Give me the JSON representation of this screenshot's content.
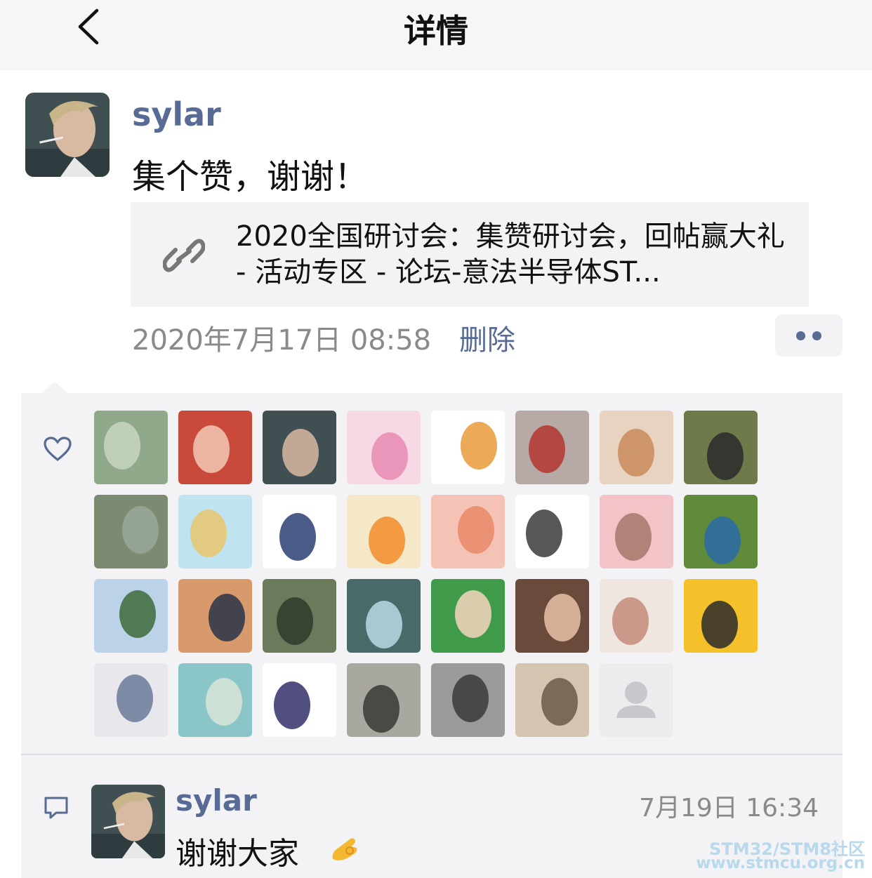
{
  "nav": {
    "title": "详情",
    "back_icon": "chevron-left-icon"
  },
  "post": {
    "username": "sylar",
    "text": "集个赞，谢谢！",
    "link": {
      "icon": "link-icon",
      "title": "2020全国研讨会：集赞研讨会，回帖赢大礼 - 活动专区 - 论坛-意法半导体ST..."
    },
    "time": "2020年7月17日 08:58",
    "delete_label": "删除",
    "more_icon": "more-dots-icon"
  },
  "likes": {
    "icon": "heart-icon",
    "count": 31,
    "placeholder_icon": "person-placeholder-icon"
  },
  "comments": [
    {
      "icon": "comment-icon",
      "username": "sylar",
      "time": "7月19日 16:34",
      "text": "谢谢大家",
      "emoji": "ok-hand-emoji"
    }
  ],
  "watermark": {
    "line1": "STM32/STM8社区",
    "line2": "www.stmcu.org.cn"
  },
  "colors": {
    "link_blue": "#576b95",
    "panel_bg": "#f3f3f5",
    "nav_bg": "#f6f6f6",
    "meta_gray": "#8a8a8a"
  }
}
